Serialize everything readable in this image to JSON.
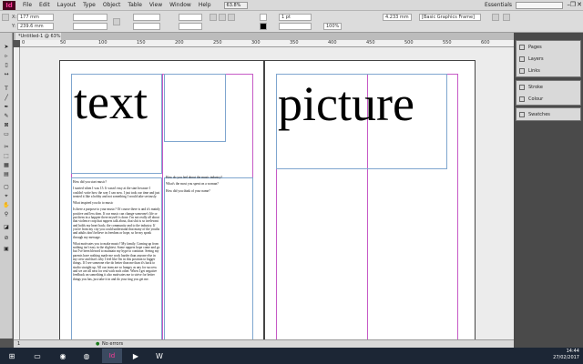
{
  "app": {
    "logo": "Id",
    "menu": [
      "File",
      "Edit",
      "Layout",
      "Type",
      "Object",
      "Table",
      "View",
      "Window",
      "Help"
    ],
    "zoom": "63.8%",
    "workspace": "Essentials",
    "window_controls": [
      "–",
      "❐",
      "✕"
    ]
  },
  "control": {
    "x_label": "X:",
    "x_value": "177 mm",
    "y_label": "Y:",
    "y_value": "239.6 mm",
    "stroke_weight": "1 pt",
    "opacity": "100%",
    "dimension": "4.233 mm",
    "object_style": "[Basic Graphics Frame]"
  },
  "document": {
    "tab_title": "*Untitled-1 @ 63%",
    "ruler_marks": [
      "0",
      "50",
      "100",
      "150",
      "200",
      "250",
      "300",
      "350",
      "400",
      "450",
      "500",
      "550",
      "600"
    ],
    "headline_left": "text",
    "headline_right": "picture",
    "body_col1": [
      "How did you start music?",
      "I started when I was 15. It wasn't easy at the start because I couldn't write how the way I can now. I just took our time and just treated it like a hobby and not something I would take seriously.",
      "What inspired you do to music",
      "Is there a purpose to your music? Of course there is and it's mainly positive and less dom. If our music can change someone's life or put them in a happier there myself is done. I'm not really all about that violence crap that rappers talk about, that shit is so irrelevant and holds my heart back; the community and to the industry. If you're from my city you could understand that many of the youths and adults don't believe in freedom or hope, so be my speak through my message.",
      "What motivates you to make music? My family. Coming up from nothing isn't easy in the slightest. Some rappers hope come and go but I've been blessed to maintain my hype to continue. Seeing my parents have nothing made me work harder than anyone else in my crew and that's why I feel like I'm in this position to bigger things. If I see someone else do better than me than it's back to studio straight up. All our team are so hungry as any for success and we are all next for real with each other. When I get negative feedback on something it also motivates me to strive for better things you has, just take it in and do your ting you get me."
    ],
    "body_col2": [
      "How do you feel about the music industry?",
      "What's the most you spent on a woman?",
      "How did you think of your name?"
    ]
  },
  "status": {
    "page": "1",
    "preflight": "No errors"
  },
  "panels": [
    {
      "items": [
        {
          "icon": "pages-icon",
          "label": "Pages"
        },
        {
          "icon": "layers-icon",
          "label": "Layers"
        },
        {
          "icon": "links-icon",
          "label": "Links"
        }
      ]
    },
    {
      "items": [
        {
          "icon": "stroke-icon",
          "label": "Stroke"
        },
        {
          "icon": "colour-icon",
          "label": "Colour"
        }
      ]
    },
    {
      "items": [
        {
          "icon": "swatches-icon",
          "label": "Swatches"
        }
      ]
    }
  ],
  "taskbar": {
    "time": "14:44",
    "date": "27/02/2017"
  },
  "colors": {
    "indesign_bg": "#49021f",
    "indesign_fg": "#ff3b9a",
    "margin_guide": "#c65ac6",
    "frame_edge": "#7fa6cf"
  }
}
